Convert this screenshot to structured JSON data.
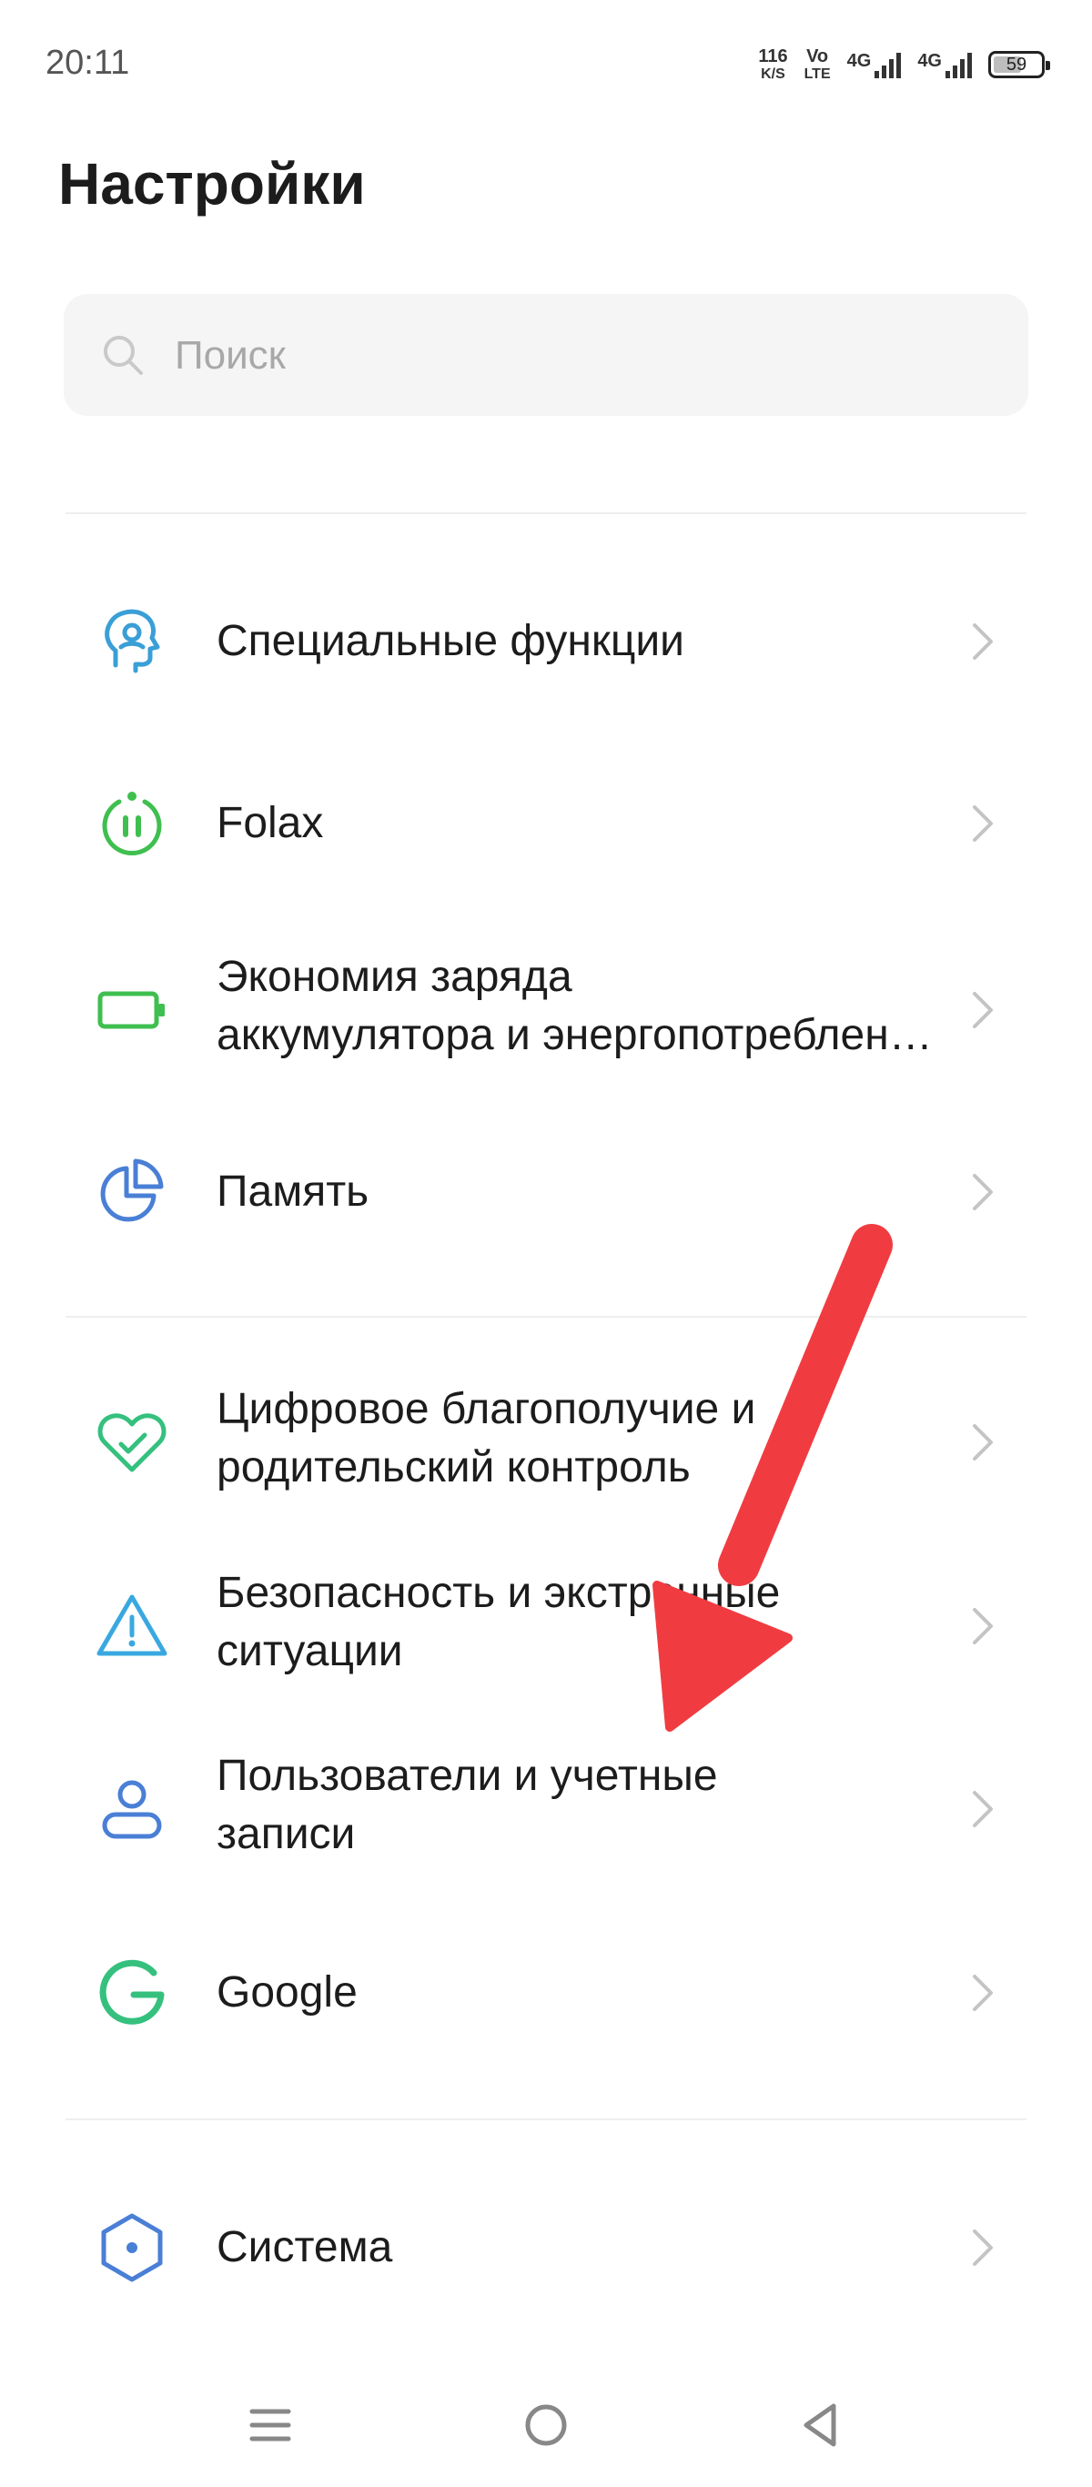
{
  "status": {
    "time": "20:11",
    "speed_value": "116",
    "speed_unit": "K/S",
    "volte_top": "Vo",
    "volte_bottom": "LTE",
    "net1": "4G",
    "net2": "4G",
    "battery": "59"
  },
  "title": "Настройки",
  "search": {
    "placeholder": "Поиск"
  },
  "items": [
    {
      "label": "Специальные функции",
      "icon": "accessibility-icon",
      "color": "#3a9fd6"
    },
    {
      "label": "Folax",
      "icon": "folax-icon",
      "color": "#3fbf4f"
    },
    {
      "label_line1": "Экономия заряда",
      "label_line2": "аккумулятора и энергопотребления",
      "icon": "battery-icon",
      "color": "#3fbf4f"
    },
    {
      "label": "Память",
      "icon": "storage-pie-icon",
      "color": "#4a7fd6"
    },
    {
      "label_line1": "Цифровое благополучие и",
      "label_line2": "родительский контроль",
      "icon": "heart-icon",
      "color": "#35c07e"
    },
    {
      "label_line1": "Безопасность и экстренные",
      "label_line2": "ситуации",
      "icon": "warning-icon",
      "color": "#3aa8e0"
    },
    {
      "label_line1": "Пользователи и учетные",
      "label_line2": "записи",
      "icon": "user-icon",
      "color": "#4a7fd6"
    },
    {
      "label": "Google",
      "icon": "google-icon",
      "color": "#35c07e"
    },
    {
      "label": "Система",
      "icon": "hexagon-icon",
      "color": "#4a7fd6"
    }
  ],
  "annotation": {
    "arrow_color": "#f03c41"
  },
  "navbar": {
    "icons": [
      "menu-icon",
      "home-icon",
      "back-icon"
    ]
  }
}
